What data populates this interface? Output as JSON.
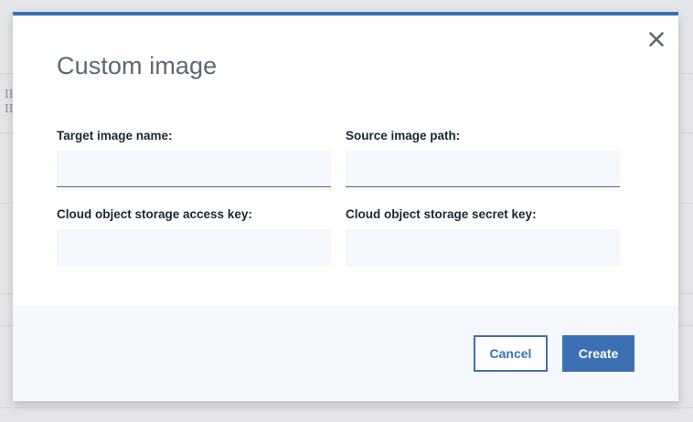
{
  "background": {
    "rows": [
      "IE",
      "IE"
    ]
  },
  "modal": {
    "title": "Custom image",
    "close_icon": "close-icon",
    "fields": [
      {
        "label": "Target image name:",
        "value": "",
        "placeholder": ""
      },
      {
        "label": "Source image path:",
        "value": "",
        "placeholder": ""
      },
      {
        "label": "Cloud object storage access key:",
        "value": "",
        "placeholder": ""
      },
      {
        "label": "Cloud object storage secret key:",
        "value": "",
        "placeholder": ""
      }
    ],
    "footer": {
      "cancel_label": "Cancel",
      "create_label": "Create"
    }
  },
  "colors": {
    "accent": "#3d70b2",
    "input_bg": "#f4f7fb",
    "title": "#5a6872",
    "label": "#152935"
  }
}
